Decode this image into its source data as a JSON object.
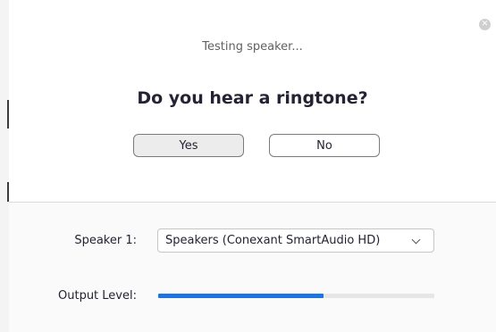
{
  "dialog": {
    "status_text": "Testing speaker...",
    "question": "Do you hear a ringtone?",
    "yes_label": "Yes",
    "no_label": "No",
    "close_icon": "close-icon"
  },
  "settings": {
    "speaker_label": "Speaker 1:",
    "speaker_selected": "Speakers (Conexant SmartAudio HD)",
    "output_label": "Output Level:",
    "output_level": 0.6
  },
  "colors": {
    "accent": "#1c75e3",
    "track": "#e6e6e6",
    "text": "#232333"
  }
}
